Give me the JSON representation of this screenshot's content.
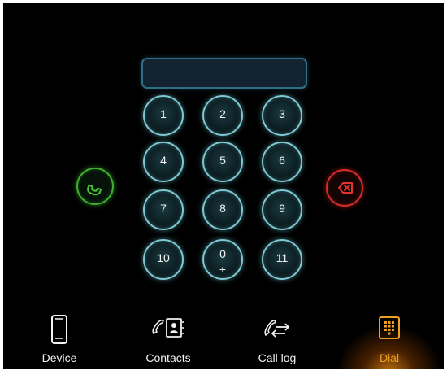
{
  "dialer": {
    "display_value": "",
    "keys": [
      {
        "digit": "1",
        "sub": ""
      },
      {
        "digit": "2",
        "sub": ""
      },
      {
        "digit": "3",
        "sub": ""
      },
      {
        "digit": "4",
        "sub": ""
      },
      {
        "digit": "5",
        "sub": ""
      },
      {
        "digit": "6",
        "sub": ""
      },
      {
        "digit": "7",
        "sub": ""
      },
      {
        "digit": "8",
        "sub": ""
      },
      {
        "digit": "9",
        "sub": ""
      },
      {
        "digit": "10",
        "sub": ""
      },
      {
        "digit": "0",
        "sub": "+"
      },
      {
        "digit": "11",
        "sub": ""
      }
    ],
    "call_icon": "phone-handset-icon",
    "delete_icon": "backspace-icon"
  },
  "nav": {
    "items": [
      {
        "label": "Device",
        "icon": "smartphone-icon",
        "active": false
      },
      {
        "label": "Contacts",
        "icon": "contacts-icon",
        "active": false
      },
      {
        "label": "Call log",
        "icon": "call-log-icon",
        "active": false
      },
      {
        "label": "Dial",
        "icon": "dialpad-icon",
        "active": true
      }
    ]
  },
  "colors": {
    "background": "#000000",
    "key_ring": "#7fc9d3",
    "call": "#3fae2e",
    "delete": "#d82a2a",
    "active_tab": "#f0a020"
  }
}
